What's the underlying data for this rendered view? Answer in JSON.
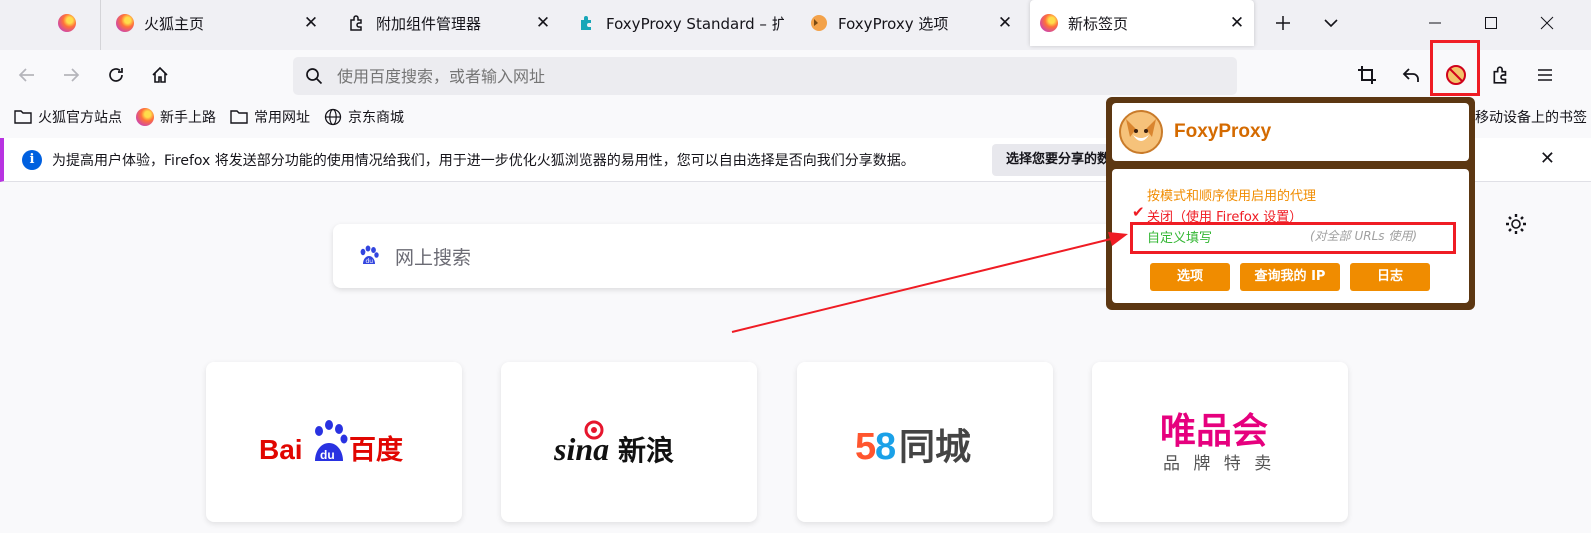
{
  "tabs": [
    {
      "title": ""
    },
    {
      "title": "火狐主页"
    },
    {
      "title": "附加组件管理器"
    },
    {
      "title": "FoxyProxy Standard – 扩"
    },
    {
      "title": "FoxyProxy 选项"
    },
    {
      "title": "新标签页"
    }
  ],
  "urlbar": {
    "placeholder": "使用百度搜索，或者输入网址"
  },
  "bookmarks": [
    {
      "label": "火狐官方站点"
    },
    {
      "label": "新手上路"
    },
    {
      "label": "常用网址"
    },
    {
      "label": "京东商城"
    },
    {
      "label": "移动设备上的书签"
    }
  ],
  "notification": {
    "message": "为提高用户体验，Firefox 将发送部分功能的使用情况给我们，用于进一步优化火狐浏览器的易用性，您可以自由选择是否向我们分享数据。",
    "button": "选择您要分享的数据"
  },
  "search": {
    "placeholder": "网上搜索"
  },
  "tiles": [
    {
      "name": "Baidu百度"
    },
    {
      "name": "sina新浪"
    },
    {
      "name": "58同城"
    },
    {
      "name": "唯品会",
      "tagline": "品 牌 特 卖"
    }
  ],
  "foxyproxy": {
    "title": "FoxyProxy",
    "option_patterns": "按模式和顺序使用启用的代理",
    "option_off": "关闭（使用 Firefox 设置）",
    "option_custom": "自定义填写",
    "option_custom_note": "(对全部 URLs 使用)",
    "btn_options": "选项",
    "btn_myip": "查询我的 IP",
    "btn_log": "日志"
  },
  "colors": {
    "accent": "#f08c00",
    "highlight": "#ef1c24",
    "panel": "#5c3712"
  }
}
